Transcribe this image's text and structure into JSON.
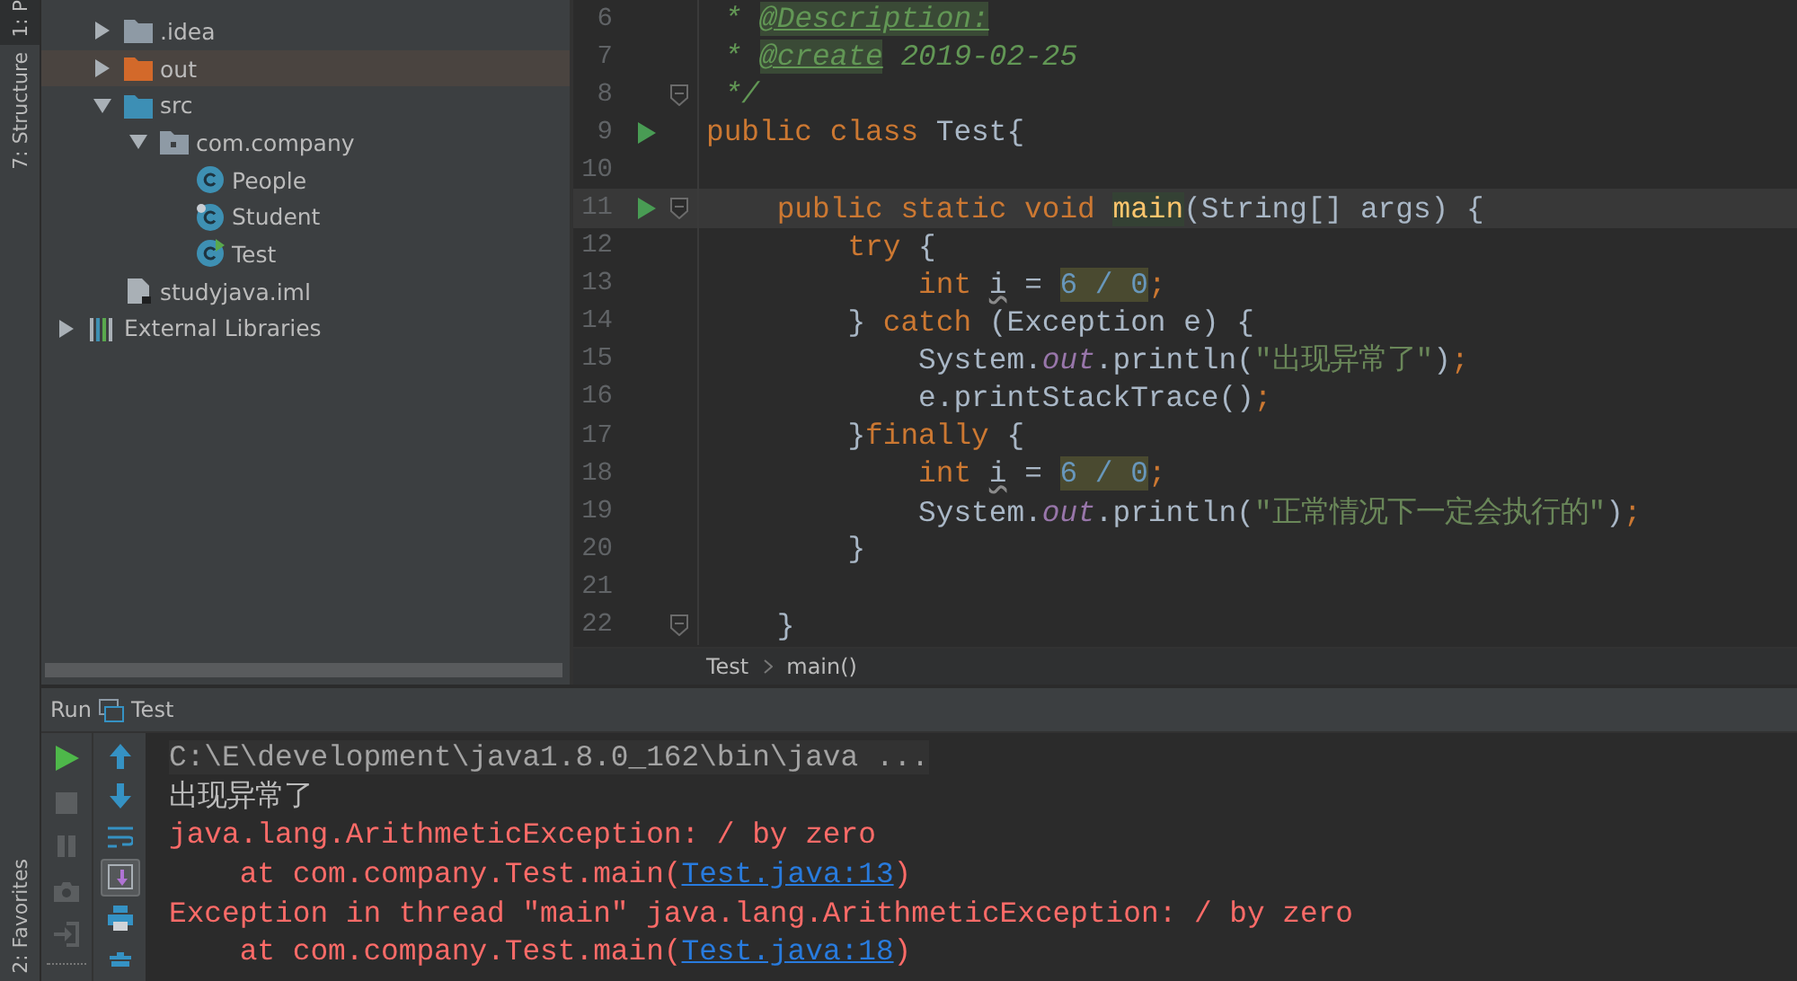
{
  "side_tabs": [
    {
      "label": "1: P",
      "selected": true
    },
    {
      "label": "7: Structure",
      "selected": false
    }
  ],
  "bottom_side_tabs": [
    {
      "label": "2: Favorites",
      "selected": false
    }
  ],
  "project_tree": [
    {
      "label": ".idea",
      "kind": "folder",
      "expanded": false,
      "selected": false
    },
    {
      "label": "out",
      "kind": "folder-excluded",
      "expanded": false,
      "selected": true
    },
    {
      "label": "src",
      "kind": "folder-source",
      "expanded": true,
      "selected": false,
      "children": [
        {
          "label": "com.company",
          "kind": "package",
          "expanded": true,
          "selected": false,
          "children": [
            {
              "label": "People",
              "kind": "class",
              "selected": false
            },
            {
              "label": "Student",
              "kind": "class-pinned",
              "selected": false
            },
            {
              "label": "Test",
              "kind": "class-run",
              "selected": false
            }
          ]
        }
      ]
    },
    {
      "label": "studyjava.iml",
      "kind": "file",
      "selected": false
    }
  ],
  "external_libraries": {
    "label": "External Libraries",
    "expanded": false,
    "selected": false
  },
  "editor": {
    "lines": [
      {
        "number": "6",
        "run": false,
        "fold": false,
        "current": false,
        "tokens": [
          {
            "t": " * ",
            "kind": "comment"
          },
          {
            "t": "@Description:",
            "kind": "tag"
          }
        ]
      },
      {
        "number": "7",
        "run": false,
        "fold": false,
        "current": false,
        "tokens": [
          {
            "t": " * ",
            "kind": "comment"
          },
          {
            "t": "@create",
            "kind": "tag"
          },
          {
            "t": " 2019-02-25",
            "kind": "comment"
          }
        ]
      },
      {
        "number": "8",
        "run": false,
        "fold": true,
        "current": false,
        "tokens": [
          {
            "t": " */",
            "kind": "comment"
          }
        ]
      },
      {
        "number": "9",
        "run": true,
        "fold": false,
        "current": false,
        "tokens": [
          {
            "t": "public class ",
            "kind": "keyword"
          },
          {
            "t": "Test{",
            "kind": "plain"
          }
        ]
      },
      {
        "number": "10",
        "run": false,
        "fold": false,
        "current": false
      },
      {
        "number": "11",
        "run": true,
        "fold": true,
        "current": true,
        "tokens": [
          {
            "t": "    public static void ",
            "kind": "keyword"
          },
          {
            "t": "main",
            "kind": "method-highlight"
          },
          {
            "t": "(String[] args) {",
            "kind": "plain"
          }
        ]
      },
      {
        "number": "12",
        "run": false,
        "fold": false,
        "current": false,
        "tokens": [
          {
            "t": "        try ",
            "kind": "keyword"
          },
          {
            "t": "{",
            "kind": "plain"
          }
        ]
      },
      {
        "number": "13",
        "run": false,
        "fold": false,
        "current": false,
        "tokens": [
          {
            "t": "            int ",
            "kind": "keyword"
          },
          {
            "t": "i",
            "kind": "warning"
          },
          {
            "t": " = ",
            "kind": "plain"
          },
          {
            "t": "6 / 0",
            "kind": "number-highlight"
          },
          {
            "t": ";",
            "kind": "keyword"
          }
        ]
      },
      {
        "number": "14",
        "run": false,
        "fold": false,
        "current": false,
        "tokens": [
          {
            "t": "        } ",
            "kind": "plain"
          },
          {
            "t": "catch ",
            "kind": "keyword"
          },
          {
            "t": "(Exception e) {",
            "kind": "plain"
          }
        ]
      },
      {
        "number": "15",
        "run": false,
        "fold": false,
        "current": false,
        "tokens": [
          {
            "t": "            System.",
            "kind": "plain"
          },
          {
            "t": "out",
            "kind": "field"
          },
          {
            "t": ".println(",
            "kind": "plain"
          },
          {
            "t": "\"出现异常了\"",
            "kind": "string"
          },
          {
            "t": ")",
            "kind": "plain"
          },
          {
            "t": ";",
            "kind": "keyword"
          }
        ]
      },
      {
        "number": "16",
        "run": false,
        "fold": false,
        "current": false,
        "tokens": [
          {
            "t": "            e.printStackTrace()",
            "kind": "plain"
          },
          {
            "t": ";",
            "kind": "keyword"
          }
        ]
      },
      {
        "number": "17",
        "run": false,
        "fold": false,
        "current": false,
        "tokens": [
          {
            "t": "        }",
            "kind": "plain"
          },
          {
            "t": "finally ",
            "kind": "keyword"
          },
          {
            "t": "{",
            "kind": "plain"
          }
        ]
      },
      {
        "number": "18",
        "run": false,
        "fold": false,
        "current": false,
        "tokens": [
          {
            "t": "            int ",
            "kind": "keyword"
          },
          {
            "t": "i",
            "kind": "warning"
          },
          {
            "t": " = ",
            "kind": "plain"
          },
          {
            "t": "6 / 0",
            "kind": "number-highlight"
          },
          {
            "t": ";",
            "kind": "keyword"
          }
        ]
      },
      {
        "number": "19",
        "run": false,
        "fold": false,
        "current": false,
        "tokens": [
          {
            "t": "            System.",
            "kind": "plain"
          },
          {
            "t": "out",
            "kind": "field"
          },
          {
            "t": ".println(",
            "kind": "plain"
          },
          {
            "t": "\"正常情况下一定会执行的\"",
            "kind": "string"
          },
          {
            "t": ")",
            "kind": "plain"
          },
          {
            "t": ";",
            "kind": "keyword"
          }
        ]
      },
      {
        "number": "20",
        "run": false,
        "fold": false,
        "current": false,
        "tokens": [
          {
            "t": "        }",
            "kind": "plain"
          }
        ]
      },
      {
        "number": "21",
        "run": false,
        "fold": false,
        "current": false
      },
      {
        "number": "22",
        "run": false,
        "fold": true,
        "current": false,
        "tokens": [
          {
            "t": "    }",
            "kind": "plain"
          }
        ]
      }
    ],
    "breadcrumbs": [
      "Test",
      "main()"
    ]
  },
  "run_panel": {
    "title": "Run",
    "config": "Test",
    "left_tools": [
      {
        "kind": "run",
        "disabled": false
      },
      {
        "kind": "stop",
        "disabled": true
      },
      {
        "kind": "pause",
        "disabled": true
      },
      {
        "kind": "camera",
        "disabled": true
      },
      {
        "kind": "exit",
        "disabled": true
      }
    ],
    "right_tools": [
      {
        "kind": "up",
        "selected": false
      },
      {
        "kind": "down",
        "selected": false
      },
      {
        "kind": "wrap",
        "selected": false
      },
      {
        "kind": "scroll-end",
        "selected": true
      },
      {
        "kind": "print",
        "selected": false
      },
      {
        "kind": "trash",
        "selected": false
      }
    ],
    "console": [
      {
        "kind": "command",
        "parts": [
          {
            "t": "C:\\E\\development\\java1.8.0_162\\bin\\java ...",
            "kind": "text"
          }
        ]
      },
      {
        "kind": "output",
        "parts": [
          {
            "t": "出现异常了",
            "kind": "text"
          }
        ]
      },
      {
        "kind": "error",
        "parts": [
          {
            "t": "java.lang.ArithmeticException: / by zero",
            "kind": "text"
          }
        ]
      },
      {
        "kind": "error",
        "parts": [
          {
            "t": "    at com.company.Test.main(",
            "kind": "text"
          },
          {
            "t": "Test.java:13",
            "kind": "link"
          },
          {
            "t": ")",
            "kind": "text"
          }
        ]
      },
      {
        "kind": "error",
        "parts": [
          {
            "t": "Exception in thread \"main\" java.lang.ArithmeticException: / by zero",
            "kind": "text"
          }
        ]
      },
      {
        "kind": "error",
        "parts": [
          {
            "t": "    at com.company.Test.main(",
            "kind": "text"
          },
          {
            "t": "Test.java:18",
            "kind": "link"
          },
          {
            "t": ")",
            "kind": "text"
          }
        ]
      }
    ]
  }
}
